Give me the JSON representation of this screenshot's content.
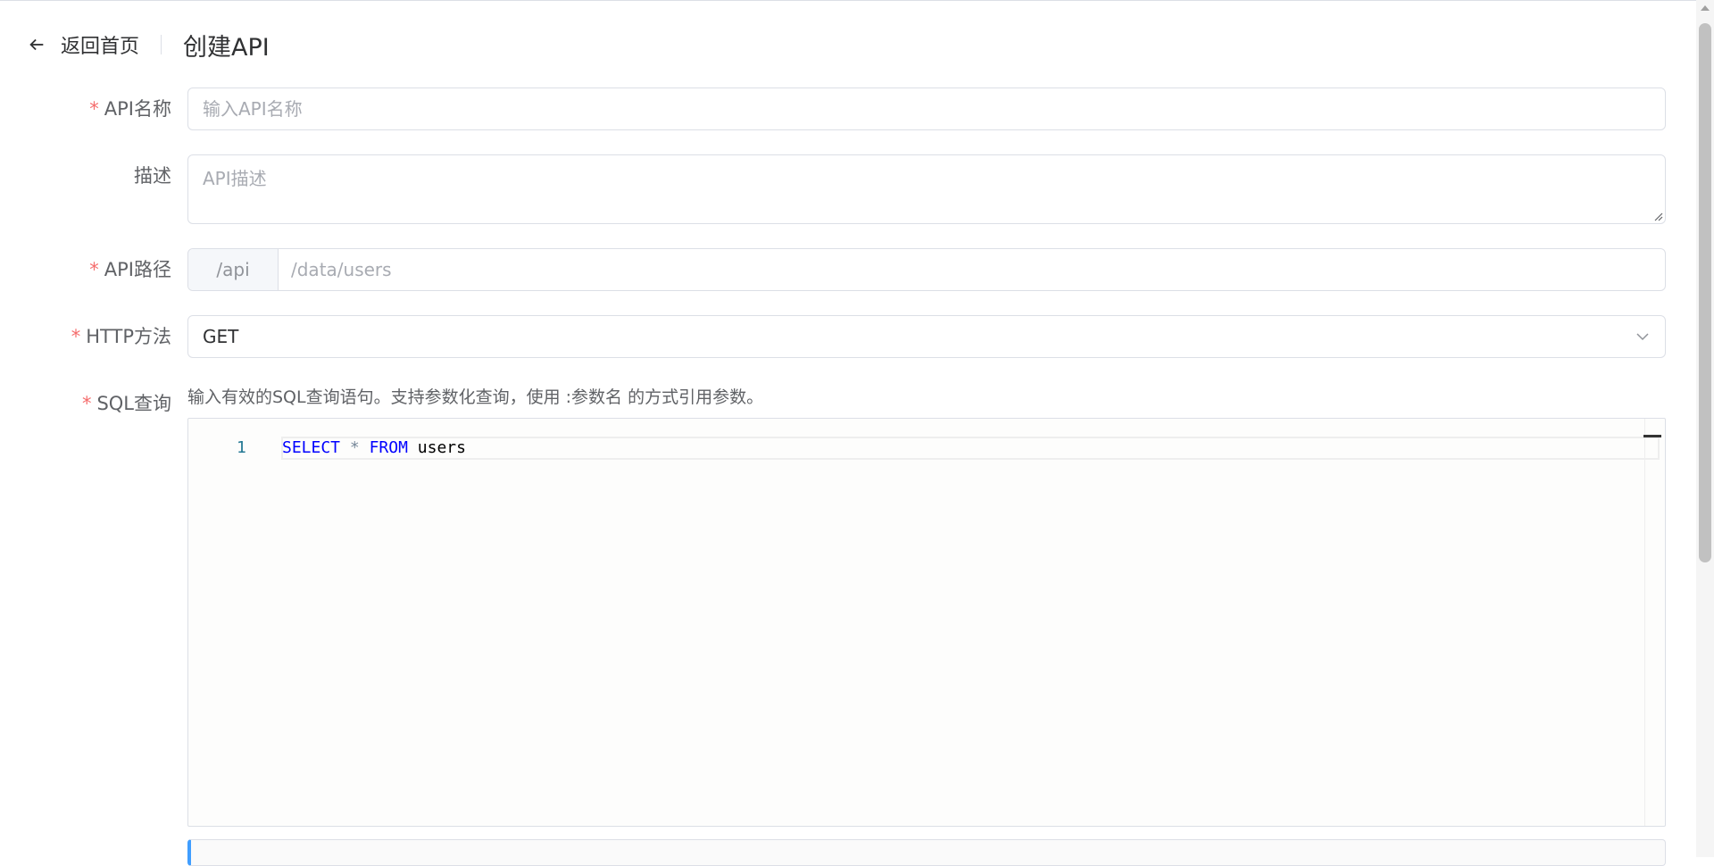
{
  "header": {
    "back_label": "返回首页",
    "title": "创建API"
  },
  "form": {
    "name": {
      "label": "API名称",
      "required_mark": "*",
      "placeholder": "输入API名称"
    },
    "description": {
      "label": "描述",
      "placeholder": "API描述"
    },
    "path": {
      "label": "API路径",
      "required_mark": "*",
      "prefix": "/api",
      "placeholder": "/data/users"
    },
    "method": {
      "label": "HTTP方法",
      "required_mark": "*",
      "value": "GET"
    },
    "sql": {
      "label": "SQL查询",
      "required_mark": "*",
      "hint": "输入有效的SQL查询语句。支持参数化查询，使用 :参数名 的方式引用参数。",
      "line_number": "1",
      "code_tokens": {
        "select": "SELECT",
        "star": "*",
        "from": "FROM",
        "table": "users"
      }
    }
  },
  "colors": {
    "required": "#f56c6c",
    "keyword": "#0000ff",
    "accent": "#409eff"
  }
}
